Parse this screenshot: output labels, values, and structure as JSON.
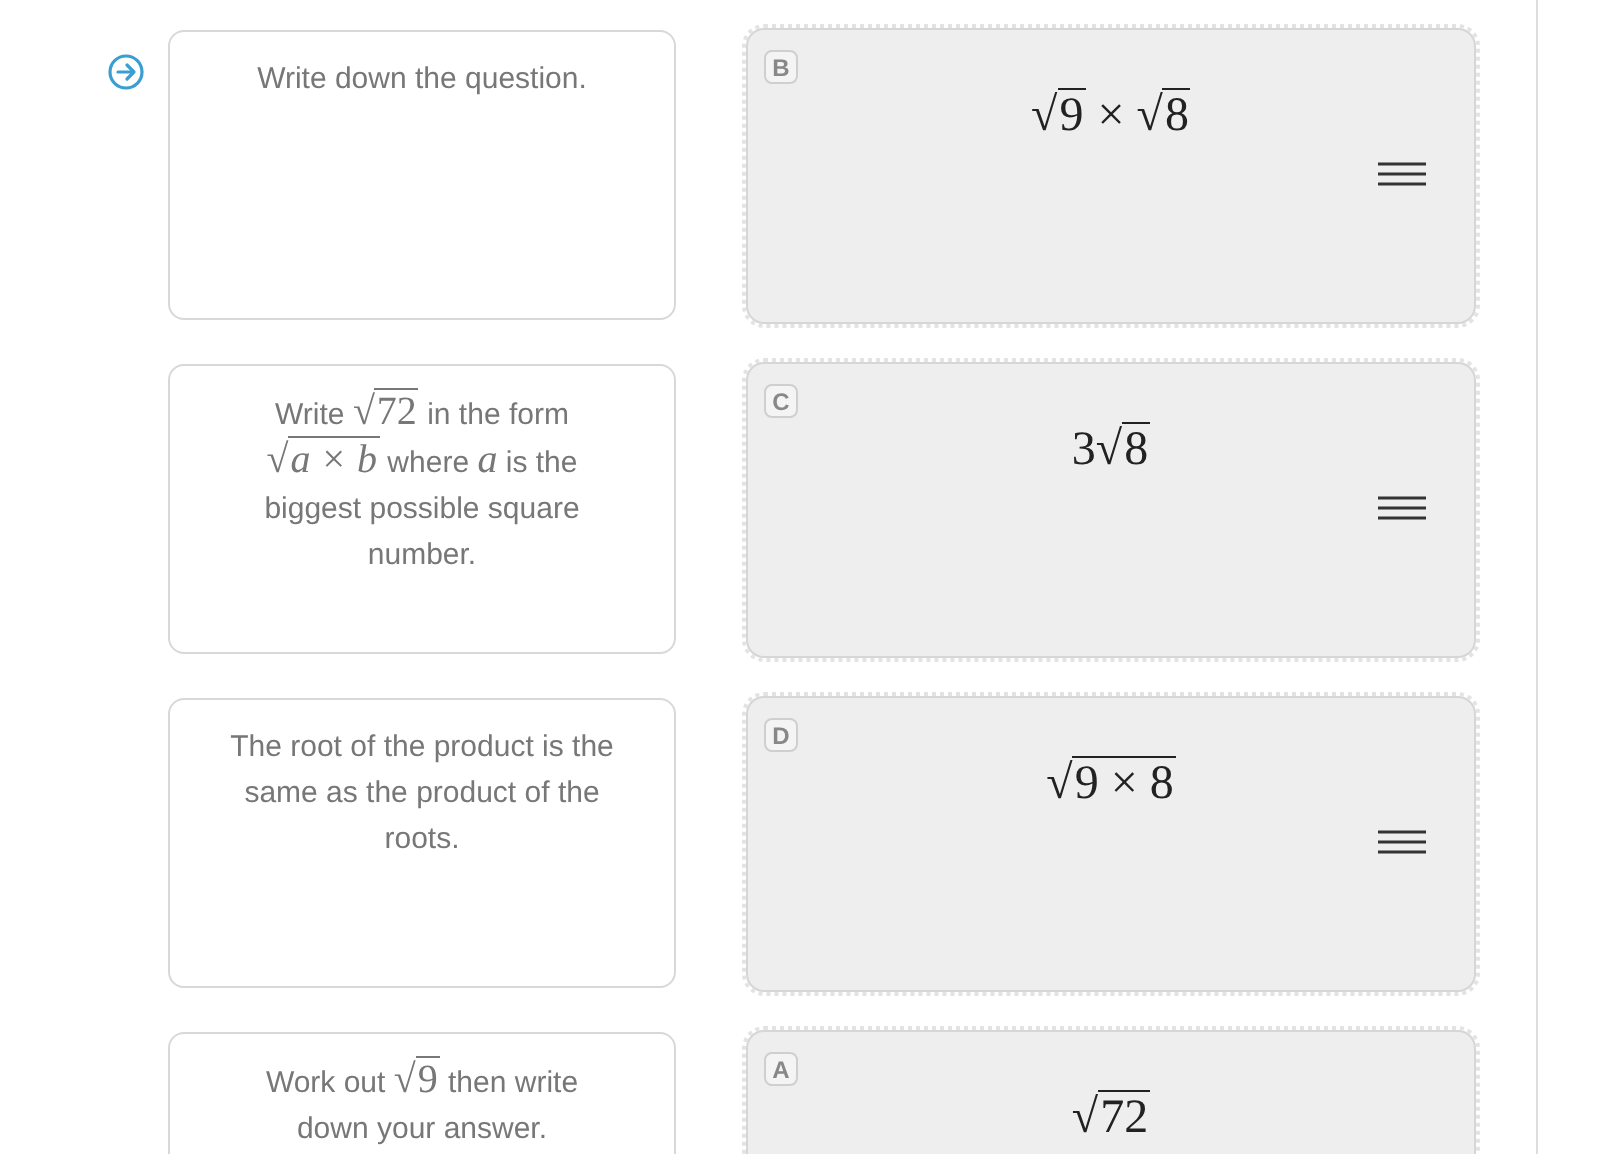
{
  "rows": [
    {
      "current": true,
      "prompt": [
        {
          "kind": "text",
          "text": "Write down the question."
        }
      ],
      "card": {
        "handle": true,
        "letter": "B",
        "math": [
          {
            "kind": "root",
            "radical": "√",
            "body": [
              {
                "kind": "num",
                "text": "9"
              }
            ]
          },
          {
            "kind": "op",
            "text": "×"
          },
          {
            "kind": "root",
            "radical": "√",
            "body": [
              {
                "kind": "num",
                "text": "8"
              }
            ]
          }
        ]
      }
    },
    {
      "current": false,
      "prompt": [
        {
          "kind": "text",
          "text": "Write "
        },
        {
          "kind": "math",
          "tokens": [
            {
              "kind": "root",
              "radical": "√",
              "body": [
                {
                  "kind": "num",
                  "text": "72"
                }
              ]
            }
          ]
        },
        {
          "kind": "text",
          "text": " in the form "
        },
        {
          "kind": "math",
          "tokens": [
            {
              "kind": "root",
              "radical": "√",
              "body": [
                {
                  "kind": "var",
                  "text": "a"
                },
                {
                  "kind": "op",
                  "text": "×"
                },
                {
                  "kind": "var",
                  "text": "b"
                }
              ]
            }
          ]
        },
        {
          "kind": "text",
          "text": " where "
        },
        {
          "kind": "math",
          "tokens": [
            {
              "kind": "var",
              "text": "a"
            }
          ]
        },
        {
          "kind": "text",
          "text": " is the biggest possible square number."
        }
      ],
      "card": {
        "handle": true,
        "letter": "C",
        "math": [
          {
            "kind": "num",
            "text": "3"
          },
          {
            "kind": "root",
            "radical": "√",
            "body": [
              {
                "kind": "num",
                "text": "8"
              }
            ]
          }
        ]
      }
    },
    {
      "current": false,
      "prompt": [
        {
          "kind": "text",
          "text": "The root of the product is the same as the product of the roots."
        }
      ],
      "card": {
        "handle": true,
        "letter": "D",
        "math": [
          {
            "kind": "root",
            "radical": "√",
            "body": [
              {
                "kind": "num",
                "text": "9"
              },
              {
                "kind": "op",
                "text": "×"
              },
              {
                "kind": "num",
                "text": "8"
              }
            ]
          }
        ]
      }
    },
    {
      "current": false,
      "prompt": [
        {
          "kind": "text",
          "text": "Work out "
        },
        {
          "kind": "math",
          "tokens": [
            {
              "kind": "root",
              "radical": "√",
              "body": [
                {
                  "kind": "num",
                  "text": "9"
                }
              ]
            }
          ]
        },
        {
          "kind": "text",
          "text": " then write down your answer."
        }
      ],
      "card": {
        "letter": "A",
        "math": [
          {
            "kind": "root",
            "radical": "√",
            "body": [
              {
                "kind": "num",
                "text": "72"
              }
            ]
          }
        ]
      }
    }
  ]
}
